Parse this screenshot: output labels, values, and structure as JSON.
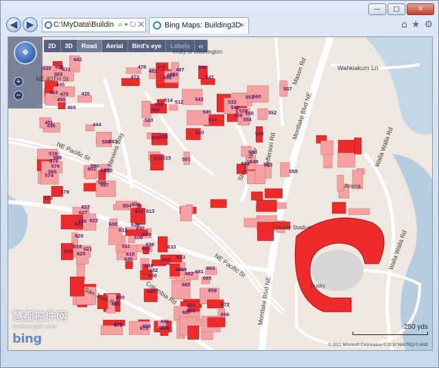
{
  "browser": {
    "address_text": "C:\\MyData\\Buildin",
    "address_tools": "⌕ ▾ ↻ ✕",
    "tab_title": "Bing Maps: Building3D",
    "tab_close": "×",
    "caption": {
      "minimize": "—",
      "maximize": "□",
      "close": "✕"
    },
    "nav": {
      "back": "◀",
      "forward": "▶"
    },
    "tools": {
      "home": "⌂",
      "favorites": "★",
      "settings": "⚙"
    }
  },
  "map_toolbar": {
    "items": [
      "2D",
      "3D",
      "Road",
      "Aerial",
      "Bird's eye",
      "Labels",
      "‹‹"
    ]
  },
  "map_controls": {
    "compass": "✥",
    "zoom_in": "+",
    "zoom_out": "−"
  },
  "scale_label": "250 yds",
  "copyright": "© 2012 Microsoft Corporation  © 2010 NAVTEQ  © AND",
  "brand": "bing",
  "watermark": {
    "line1": "慧都控件网",
    "line2": "www.evget.com"
  },
  "streets": [
    "NE Pacific St",
    "NE Pacific St",
    "Montlake Blvd NE",
    "Montlake Blvd NE",
    "Stevens Way",
    "Stevens Way",
    "Jefferson Rd",
    "Columbia Rd",
    "San Juan Rd",
    "Walla Walla Rd",
    "Walla Walla Rd",
    "Wahkiakum Ln",
    "Mason Rd",
    "NE 40TH St",
    "Arena"
  ],
  "places": [
    "Husky Stadium",
    "Husky",
    "ersity of Washington"
  ],
  "building_labels": [
    "430",
    "435",
    "442",
    "443",
    "444",
    "445",
    "446",
    "450",
    "451",
    "455",
    "463",
    "465",
    "470",
    "471",
    "473",
    "476",
    "478",
    "479",
    "481",
    "490",
    "497",
    "498",
    "500",
    "501",
    "508",
    "510",
    "512",
    "514",
    "515",
    "516",
    "520",
    "529",
    "530",
    "532",
    "534",
    "536",
    "539",
    "542",
    "543",
    "545",
    "546",
    "547",
    "549",
    "550",
    "551",
    "552",
    "553",
    "554",
    "557",
    "558",
    "559",
    "560",
    "563",
    "564",
    "565",
    "568",
    "573",
    "574",
    "575",
    "576",
    "578",
    "579",
    "583",
    "585",
    "586",
    "590",
    "595",
    "596",
    "597",
    "601",
    "602",
    "604",
    "605",
    "606",
    "608",
    "609",
    "610",
    "611",
    "612",
    "613",
    "617",
    "618",
    "620",
    "621",
    "622",
    "625",
    "626",
    "627",
    "630",
    "631",
    "633",
    "635",
    "636",
    "637",
    "638",
    "640",
    "643",
    "645",
    "646",
    "648",
    "650",
    "652",
    "654",
    "656",
    "659",
    "660",
    "661",
    "662",
    "663",
    "665",
    "666",
    "667",
    "669",
    "672",
    "673",
    "674",
    "675",
    "677",
    "680",
    "684",
    "685",
    "686",
    "688",
    "690"
  ]
}
